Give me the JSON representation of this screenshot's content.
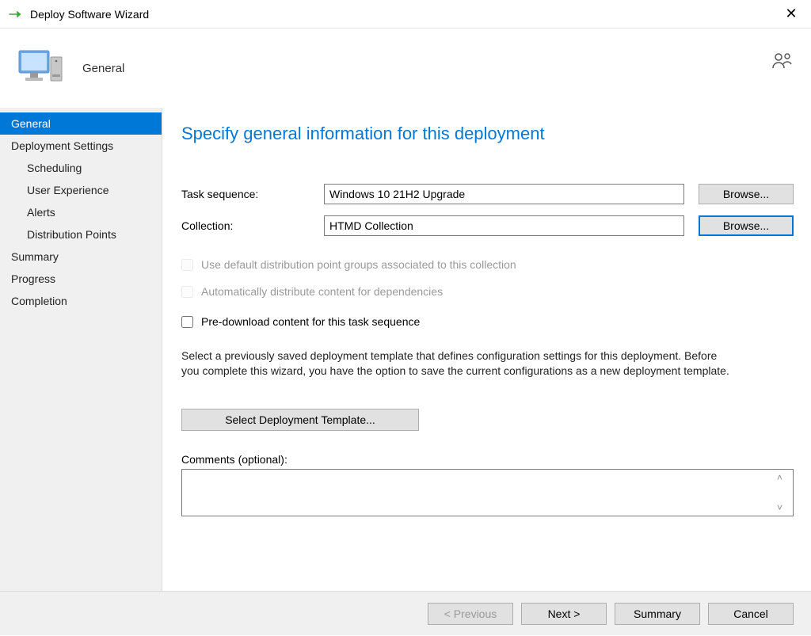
{
  "window": {
    "title": "Deploy Software Wizard"
  },
  "header": {
    "title": "General"
  },
  "sidebar": {
    "items": [
      {
        "label": "General",
        "indent": false,
        "selected": true
      },
      {
        "label": "Deployment Settings",
        "indent": false,
        "selected": false
      },
      {
        "label": "Scheduling",
        "indent": true,
        "selected": false
      },
      {
        "label": "User Experience",
        "indent": true,
        "selected": false
      },
      {
        "label": "Alerts",
        "indent": true,
        "selected": false
      },
      {
        "label": "Distribution Points",
        "indent": true,
        "selected": false
      },
      {
        "label": "Summary",
        "indent": false,
        "selected": false
      },
      {
        "label": "Progress",
        "indent": false,
        "selected": false
      },
      {
        "label": "Completion",
        "indent": false,
        "selected": false
      }
    ]
  },
  "page": {
    "heading": "Specify general information for this deployment",
    "task_sequence_label": "Task sequence:",
    "task_sequence_value": "Windows 10 21H2 Upgrade",
    "collection_label": "Collection:",
    "collection_value": "HTMD Collection",
    "browse_label": "Browse...",
    "check_default_dp": "Use default distribution point groups associated to this collection",
    "check_auto_dist": "Automatically distribute content for dependencies",
    "check_predownload": "Pre-download content for this task sequence",
    "help_text": "Select a previously saved deployment template that defines configuration settings for this deployment. Before you complete this wizard, you have the option to save the current configurations as a new deployment template.",
    "select_template_label": "Select Deployment Template...",
    "comments_label": "Comments (optional):",
    "comments_value": ""
  },
  "footer": {
    "previous": "< Previous",
    "next": "Next >",
    "summary": "Summary",
    "cancel": "Cancel"
  }
}
